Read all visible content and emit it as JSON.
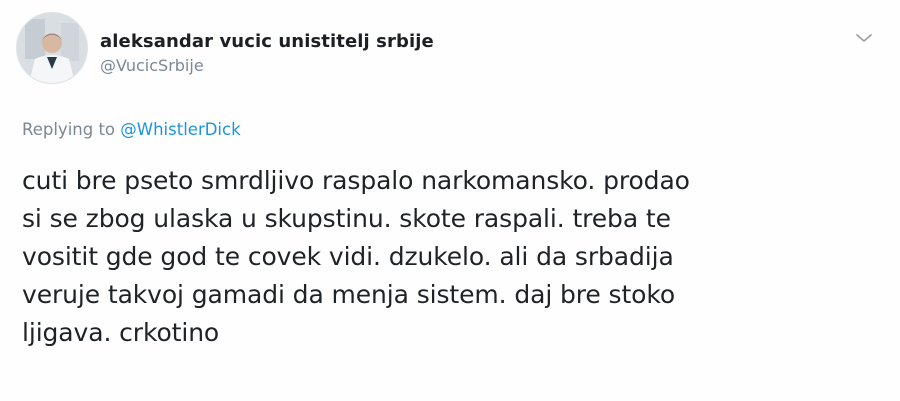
{
  "tweet": {
    "author": {
      "display_name": "aleksandar vucic unistitelj srbije",
      "handle": "@VucicSrbije",
      "avatar_icon": "profile-photo"
    },
    "menu_icon": "chevron-down-icon",
    "replying": {
      "prefix": "Replying to",
      "mention": "@WhistlerDick"
    },
    "text_lines": [
      "cuti bre pseto smrdljivo raspalo narkomansko. prodao",
      "si se zbog ulaska u skupstinu. skote raspali. treba te",
      "vositit gde god te covek vidi. dzukelo. ali da srbadija",
      "veruje takvoj gamadi da menja sistem. daj bre stoko",
      "ljigava. crkotino"
    ],
    "colors": {
      "link": "#1b95e0",
      "muted": "#7b8894",
      "text": "#1f2327"
    }
  }
}
